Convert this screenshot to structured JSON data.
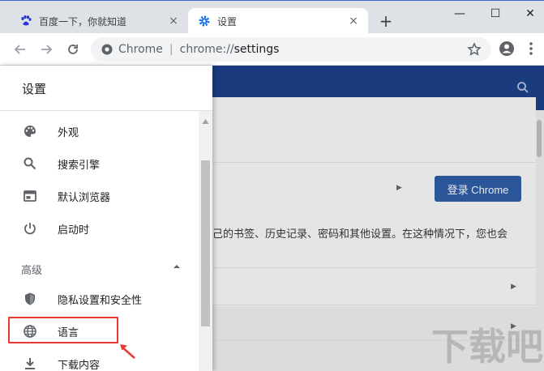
{
  "tabs": [
    {
      "title": "百度一下，你就知道",
      "close": "×",
      "favicon": "baidu-paw-icon",
      "active": false
    },
    {
      "title": "设置",
      "close": "×",
      "favicon": "gear-icon",
      "active": true
    }
  ],
  "new_tab": "+",
  "window": {
    "minimize": "—",
    "maximize": "☐",
    "close": "✕"
  },
  "toolbar": {
    "chip_label": "Chrome",
    "separator": "|",
    "url_scheme": "chrome://",
    "url_path": "settings"
  },
  "drawer": {
    "title": "设置",
    "items": [
      {
        "label": "外观",
        "icon": "palette-icon"
      },
      {
        "label": "搜索引擎",
        "icon": "search-icon"
      },
      {
        "label": "默认浏览器",
        "icon": "browser-window-icon"
      },
      {
        "label": "启动时",
        "icon": "power-icon"
      }
    ],
    "advanced_label": "高级",
    "advanced_items": [
      {
        "label": "隐私设置和安全性",
        "icon": "shield-icon"
      },
      {
        "label": "语言",
        "icon": "globe-icon"
      },
      {
        "label": "下载内容",
        "icon": "download-icon"
      }
    ]
  },
  "page": {
    "login_button": "登录 Chrome",
    "sync_text": "己的书签、历史记录、密码和其他设置。在这种情况下，您也会"
  },
  "watermark": "下载吧",
  "colors": {
    "header": "#1a3c7e",
    "login_button": "#2b579a",
    "highlight": "#e53935"
  }
}
